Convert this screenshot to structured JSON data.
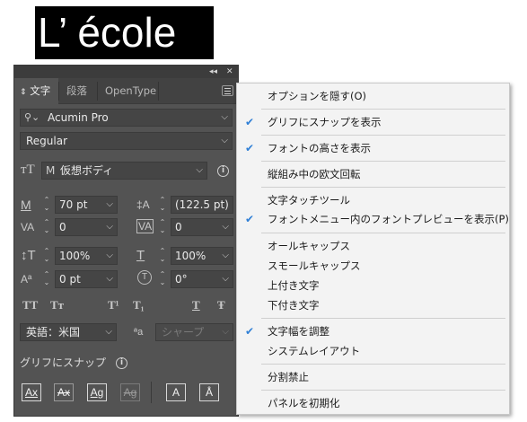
{
  "canvas_sample": {
    "text": "L’ école"
  },
  "panel": {
    "collapse_glyph": "◂◂",
    "close_glyph": "✕",
    "tabs": [
      {
        "label": "文字",
        "prefix": "⇕",
        "active": true
      },
      {
        "label": "段落",
        "active": false
      },
      {
        "label": "OpenType",
        "active": false
      }
    ],
    "font_family": "Acumin Pro",
    "font_style": "Regular",
    "frame_type": "仮想ボディ",
    "frame_prefix": "M",
    "font_size": "70 pt",
    "leading": "(122.5 pt)",
    "kerning": "0",
    "tracking": "0",
    "vertical_scale": "100%",
    "horizontal_scale": "100%",
    "baseline_shift": "0 pt",
    "rotation": "0°",
    "language": "英語：米国",
    "antialias": "シャープ",
    "antialias_icon": "ªa",
    "snap_label": "グリフにスナップ",
    "style_buttons": [
      "TT",
      "Tт",
      "T¹",
      "T₁",
      "T",
      "Ŧ"
    ],
    "glyph_buttons": [
      "Ax",
      "Ax",
      "Ag",
      "Ag",
      "A",
      "Å"
    ]
  },
  "menu": {
    "items": [
      {
        "label": "オプションを隠す(O)",
        "checked": false
      },
      {
        "label": "グリフにスナップを表示",
        "checked": true
      },
      {
        "label": "フォントの高さを表示",
        "checked": true
      },
      {
        "label": "縦組み中の欧文回転",
        "checked": false
      },
      {
        "label": "文字タッチツール",
        "checked": false
      },
      {
        "label": "フォントメニュー内のフォントプレビューを表示(P)",
        "checked": true
      },
      {
        "label": "オールキャップス",
        "checked": false
      },
      {
        "label": "スモールキャップス",
        "checked": false
      },
      {
        "label": "上付き文字",
        "checked": false
      },
      {
        "label": "下付き文字",
        "checked": false
      },
      {
        "label": "文字幅を調整",
        "checked": true
      },
      {
        "label": "システムレイアウト",
        "checked": false
      },
      {
        "label": "分割禁止",
        "checked": false
      },
      {
        "label": "パネルを初期化",
        "checked": false
      }
    ],
    "check_glyph": "✔"
  }
}
